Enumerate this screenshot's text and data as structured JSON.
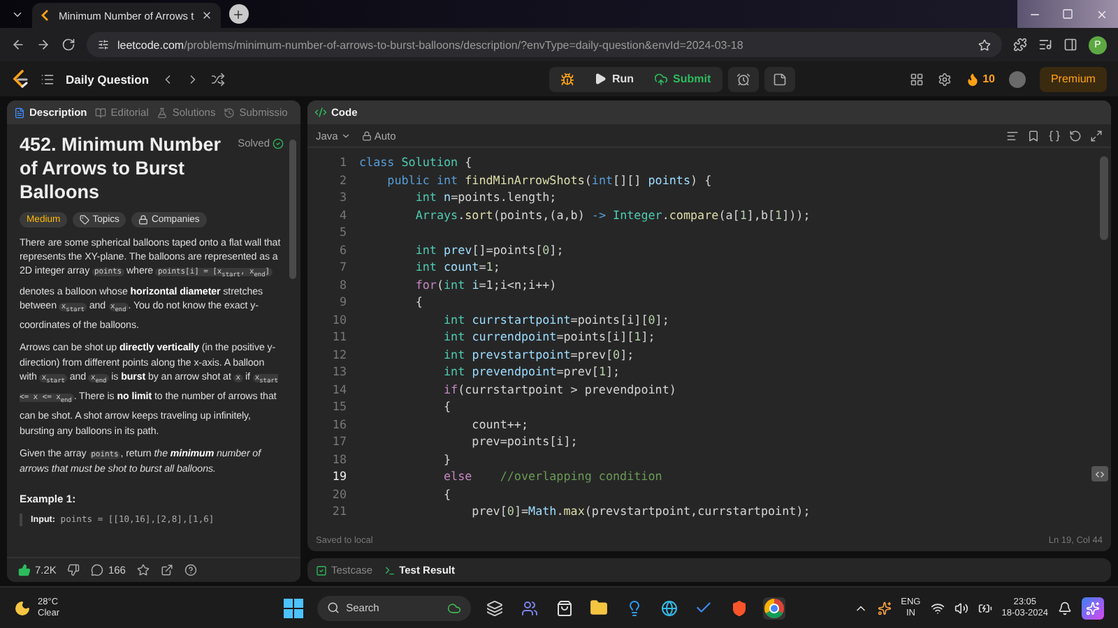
{
  "browser": {
    "tab": {
      "title": "Minimum Number of Arrows t"
    },
    "url": {
      "host": "leetcode.com",
      "path": "/problems/minimum-number-of-arrows-to-burst-balloons/description/?envType=daily-question&envId=2024-03-18"
    },
    "profile": "P"
  },
  "nav": {
    "title": "Daily Question",
    "run": "Run",
    "submit": "Submit",
    "streak": "10",
    "premium": "Premium"
  },
  "problem": {
    "tabs": [
      {
        "label": "Description",
        "kind": "description",
        "selected": true
      },
      {
        "label": "Editorial",
        "kind": "editorial",
        "selected": false
      },
      {
        "label": "Solutions",
        "kind": "solutions",
        "selected": false
      },
      {
        "label": "Submissio",
        "kind": "submissions",
        "selected": false
      }
    ],
    "title": "452. Minimum Number of Arrows to Burst Balloons",
    "status": "Solved",
    "difficulty": "Medium",
    "tags": [
      {
        "label": "Topics",
        "kind": "topics"
      },
      {
        "label": "Companies",
        "kind": "companies"
      }
    ],
    "paragraphs": [
      [
        {
          "kind": "text",
          "text": "There are some spherical balloons taped onto a flat wall that represents the XY-plane. The balloons are represented as a 2D integer array "
        },
        {
          "kind": "code",
          "text": "points"
        },
        {
          "kind": "text",
          "text": " where "
        },
        {
          "kind": "code",
          "text": "points[i] = [x$_{start}$, x$_{end}$]"
        },
        {
          "kind": "text",
          "text": " denotes a balloon whose **horizontal diameter** stretches between "
        },
        {
          "kind": "code",
          "text": "x$_{start}$"
        },
        {
          "kind": "text",
          "text": " and "
        },
        {
          "kind": "code",
          "text": "x$_{end}$"
        },
        {
          "kind": "text",
          "text": ". You do not know the exact y-coordinates of the balloons."
        }
      ],
      [
        {
          "kind": "text",
          "text": "Arrows can be shot up **directly vertically** (in the positive y-direction) from different points along the x-axis. A balloon with "
        },
        {
          "kind": "code",
          "text": "x$_{start}$"
        },
        {
          "kind": "text",
          "text": " and "
        },
        {
          "kind": "code",
          "text": "x$_{end}$"
        },
        {
          "kind": "text",
          "text": " is **burst** by an arrow shot at "
        },
        {
          "kind": "code",
          "text": "x"
        },
        {
          "kind": "text",
          "text": " if "
        },
        {
          "kind": "code",
          "text": "x$_{start}$ <= x <= x$_{end}$"
        },
        {
          "kind": "text",
          "text": ". There is **no limit** to the number of arrows that can be shot. A shot arrow keeps traveling up infinitely, bursting any balloons in its path."
        }
      ],
      [
        {
          "kind": "text",
          "text": "Given the array "
        },
        {
          "kind": "code",
          "text": "points"
        },
        {
          "kind": "text",
          "text": ", return "
        },
        {
          "kind": "emphasis",
          "text": "the **minimum** number of arrows that must be shot to burst all balloons."
        }
      ]
    ],
    "example_heading": "Example 1:",
    "example_input": "**Input:** points = [[10,16],[2,8],[1,6]",
    "likes": "7.2K",
    "comments": "166"
  },
  "editor": {
    "tab": "Code",
    "language": "Java",
    "mode": "Auto",
    "saved": "Saved to local",
    "cursor": "Ln 19, Col 44",
    "lines": [
      {
        "number": "1",
        "current": false,
        "tokens": [
          {
            "kind": "keyword",
            "text": "class "
          },
          {
            "kind": "type",
            "text": "Solution"
          },
          {
            "kind": "plain",
            "text": " {"
          }
        ]
      },
      {
        "number": "2",
        "current": false,
        "tokens": [
          {
            "kind": "keyword",
            "text": "    public int "
          },
          {
            "kind": "function",
            "text": "findMinArrowShots"
          },
          {
            "kind": "plain",
            "text": "("
          },
          {
            "kind": "keyword",
            "text": "int"
          },
          {
            "kind": "plain",
            "text": "[][] "
          },
          {
            "kind": "variable",
            "text": "points"
          },
          {
            "kind": "plain",
            "text": ") {"
          }
        ]
      },
      {
        "number": "3",
        "current": false,
        "tokens": [
          {
            "kind": "type",
            "text": "        int "
          },
          {
            "kind": "variable",
            "text": "n"
          },
          {
            "kind": "plain",
            "text": "=points.length;"
          }
        ]
      },
      {
        "number": "4",
        "current": false,
        "tokens": [
          {
            "kind": "type",
            "text": "        Arrays"
          },
          {
            "kind": "plain",
            "text": "."
          },
          {
            "kind": "function",
            "text": "sort"
          },
          {
            "kind": "plain",
            "text": "(points,(a,b) "
          },
          {
            "kind": "keyword",
            "text": "-> "
          },
          {
            "kind": "type",
            "text": "Integer"
          },
          {
            "kind": "plain",
            "text": "."
          },
          {
            "kind": "function",
            "text": "compare"
          },
          {
            "kind": "plain",
            "text": "(a["
          },
          {
            "kind": "number",
            "text": "1"
          },
          {
            "kind": "plain",
            "text": "],b["
          },
          {
            "kind": "number",
            "text": "1"
          },
          {
            "kind": "plain",
            "text": "]));"
          }
        ]
      },
      {
        "number": "5",
        "current": false
      },
      {
        "number": "6",
        "current": false,
        "tokens": [
          {
            "kind": "type",
            "text": "        int "
          },
          {
            "kind": "variable",
            "text": "prev"
          },
          {
            "kind": "plain",
            "text": "[]=points["
          },
          {
            "kind": "number",
            "text": "0"
          },
          {
            "kind": "plain",
            "text": "];"
          }
        ]
      },
      {
        "number": "7",
        "current": false,
        "tokens": [
          {
            "kind": "type",
            "text": "        int "
          },
          {
            "kind": "variable",
            "text": "count"
          },
          {
            "kind": "plain",
            "text": "="
          },
          {
            "kind": "number",
            "text": "1"
          },
          {
            "kind": "plain",
            "text": ";"
          }
        ]
      },
      {
        "number": "8",
        "current": false,
        "tokens": [
          {
            "kind": "control",
            "text": "        for"
          },
          {
            "kind": "plain",
            "text": "("
          },
          {
            "kind": "type",
            "text": "int "
          },
          {
            "kind": "variable",
            "text": "i"
          },
          {
            "kind": "plain",
            "text": "=1;i<n;i++)"
          }
        ]
      },
      {
        "number": "9",
        "current": false,
        "tokens": [
          {
            "kind": "plain",
            "text": "        {"
          }
        ]
      },
      {
        "number": "10",
        "current": false,
        "tokens": [
          {
            "kind": "type",
            "text": "            int "
          },
          {
            "kind": "variable",
            "text": "currstartpoint"
          },
          {
            "kind": "plain",
            "text": "=points[i]["
          },
          {
            "kind": "number",
            "text": "0"
          },
          {
            "kind": "plain",
            "text": "];"
          }
        ]
      },
      {
        "number": "11",
        "current": false,
        "tokens": [
          {
            "kind": "type",
            "text": "            int "
          },
          {
            "kind": "variable",
            "text": "currendpoint"
          },
          {
            "kind": "plain",
            "text": "=points[i]["
          },
          {
            "kind": "number",
            "text": "1"
          },
          {
            "kind": "plain",
            "text": "];"
          }
        ]
      },
      {
        "number": "12",
        "current": false,
        "tokens": [
          {
            "kind": "type",
            "text": "            int "
          },
          {
            "kind": "variable",
            "text": "prevstartpoint"
          },
          {
            "kind": "plain",
            "text": "=prev["
          },
          {
            "kind": "number",
            "text": "0"
          },
          {
            "kind": "plain",
            "text": "];"
          }
        ]
      },
      {
        "number": "13",
        "current": false,
        "tokens": [
          {
            "kind": "type",
            "text": "            int "
          },
          {
            "kind": "variable",
            "text": "prevendpoint"
          },
          {
            "kind": "plain",
            "text": "=prev["
          },
          {
            "kind": "number",
            "text": "1"
          },
          {
            "kind": "plain",
            "text": "];"
          }
        ]
      },
      {
        "number": "14",
        "current": false,
        "tokens": [
          {
            "kind": "control",
            "text": "            if"
          },
          {
            "kind": "plain",
            "text": "(currstartpoint > prevendpoint)"
          }
        ]
      },
      {
        "number": "15",
        "current": false,
        "tokens": [
          {
            "kind": "plain",
            "text": "            {"
          }
        ]
      },
      {
        "number": "16",
        "current": false,
        "tokens": [
          {
            "kind": "plain",
            "text": "                count++;"
          }
        ]
      },
      {
        "number": "17",
        "current": false,
        "tokens": [
          {
            "kind": "plain",
            "text": "                prev=points[i];"
          }
        ]
      },
      {
        "number": "18",
        "current": false,
        "tokens": [
          {
            "kind": "plain",
            "text": "            }"
          }
        ]
      },
      {
        "number": "19",
        "current": true,
        "tokens": [
          {
            "kind": "control",
            "text": "            else    "
          },
          {
            "kind": "comment",
            "text": "//overlapping condition"
          }
        ]
      },
      {
        "number": "20",
        "current": false,
        "tokens": [
          {
            "kind": "plain",
            "text": "            {"
          }
        ]
      },
      {
        "number": "21",
        "current": false,
        "tokens": [
          {
            "kind": "plain",
            "text": "                prev["
          },
          {
            "kind": "number",
            "text": "0"
          },
          {
            "kind": "plain",
            "text": "]="
          },
          {
            "kind": "variable",
            "text": "Math"
          },
          {
            "kind": "plain",
            "text": "."
          },
          {
            "kind": "function",
            "text": "max"
          },
          {
            "kind": "plain",
            "text": "(prevstartpoint,currstartpoint);"
          }
        ]
      }
    ]
  },
  "bottom_tabs": [
    {
      "label": "Testcase",
      "kind": "testcase",
      "selected": false
    },
    {
      "label": "Test Result",
      "kind": "result",
      "selected": true
    }
  ],
  "taskbar": {
    "temperature": "28°C",
    "weather": "Clear",
    "search": "Search",
    "language": "ENG",
    "region": "IN",
    "time": "23:05",
    "date": "18-03-2024"
  }
}
